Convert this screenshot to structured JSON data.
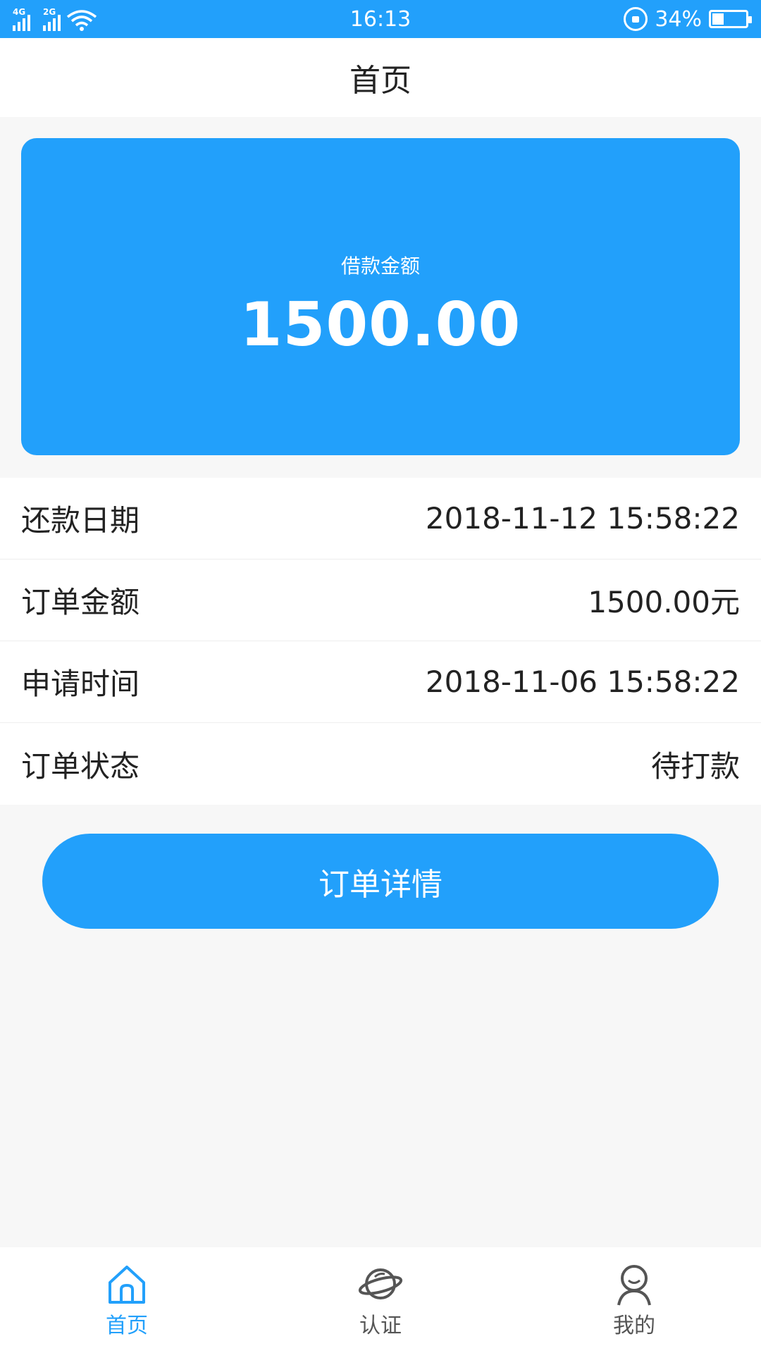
{
  "status_bar": {
    "network_1": "4G",
    "network_2": "2G",
    "time": "16:13",
    "battery_text": "34%",
    "battery_level": 0.34
  },
  "header": {
    "title": "首页"
  },
  "loan_card": {
    "label": "借款金额",
    "amount": "1500.00"
  },
  "info": [
    {
      "label": "还款日期",
      "value": "2018-11-12 15:58:22"
    },
    {
      "label": "订单金额",
      "value": "1500.00元"
    },
    {
      "label": "申请时间",
      "value": "2018-11-06 15:58:22"
    },
    {
      "label": "订单状态",
      "value": "待打款"
    }
  ],
  "detail_button": {
    "label": "订单详情"
  },
  "tabs": [
    {
      "label": "首页",
      "icon": "home-icon",
      "active": true
    },
    {
      "label": "认证",
      "icon": "planet-icon",
      "active": false
    },
    {
      "label": "我的",
      "icon": "user-icon",
      "active": false
    }
  ],
  "colors": {
    "accent": "#22a0fb",
    "background": "#f7f7f7",
    "text": "#222222",
    "inactive": "#555555"
  }
}
